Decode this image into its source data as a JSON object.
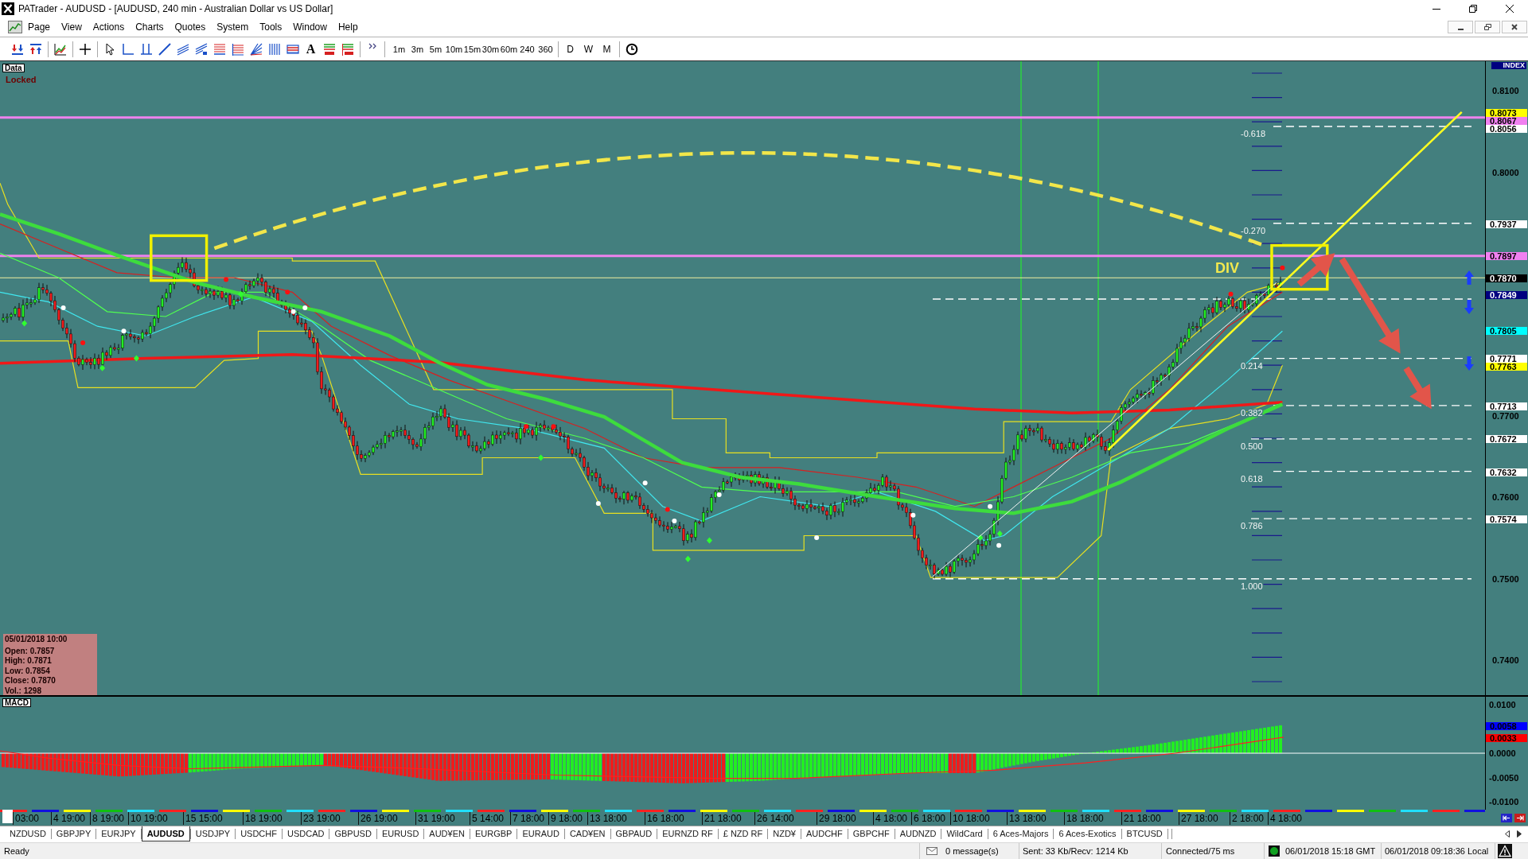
{
  "window": {
    "title": "PATrader - AUDUSD - [AUDUSD, 240 min - Australian Dollar vs US Dollar]"
  },
  "menu": [
    "Page",
    "View",
    "Actions",
    "Charts",
    "Quotes",
    "System",
    "Tools",
    "Window",
    "Help"
  ],
  "toolbar": {
    "text_tool": "A",
    "timeframes": [
      "1m",
      "3m",
      "5m",
      "10m",
      "15m",
      "30m",
      "60m",
      "240",
      "360"
    ],
    "periods": [
      "D",
      "W",
      "M"
    ]
  },
  "chart": {
    "data_tag": "Data",
    "lock_status": "Locked",
    "annotation": "DIV",
    "fib_levels": [
      "-0.618",
      "-0.270",
      "0.214",
      "0.382",
      "0.500",
      "0.618",
      "0.786",
      "1.000"
    ],
    "ohlc": {
      "date": "05/01/2018 10:00",
      "lines": [
        "Open: 0.7857",
        "High: 0.7871",
        "Low: 0.7854",
        "Close: 0.7870",
        "Vol.: 1298"
      ]
    },
    "y_axis": {
      "title": "INDEX",
      "labels": [
        "0.8100",
        "0.8000",
        "0.7700",
        "0.7600",
        "0.7500",
        "0.7400"
      ]
    },
    "price_tags": [
      {
        "text": "0.8073",
        "color": "#ffff00"
      },
      {
        "text": "0.8067",
        "color": "#f080f0"
      },
      {
        "text": "0.8056",
        "color": "#ffffff"
      },
      {
        "text": "0.7937",
        "color": "#ffffff"
      },
      {
        "text": "0.7897",
        "color": "#f080f0"
      },
      {
        "text": "0.7870",
        "color": "#000000"
      },
      {
        "text": "0.7849",
        "color": "#000080"
      },
      {
        "text": "0.7805",
        "color": "#00ffff"
      },
      {
        "text": "0.7771",
        "color": "#ffffff"
      },
      {
        "text": "0.7763",
        "color": "#ffff00"
      },
      {
        "text": "0.7713",
        "color": "#ffffff"
      },
      {
        "text": "0.7672",
        "color": "#ffffff"
      },
      {
        "text": "0.7632",
        "color": "#ffffff"
      },
      {
        "text": "0.7574",
        "color": "#ffffff"
      }
    ]
  },
  "macd": {
    "title": "MACD",
    "y_axis": [
      "0.0100",
      "0.0000",
      "-0.0050",
      "-0.0100"
    ],
    "tags": [
      {
        "text": "0.0058",
        "color": "#0000ff"
      },
      {
        "text": "0.0033",
        "color": "#ff0000"
      }
    ]
  },
  "x_axis": [
    "03:00",
    "4 19:00",
    "8 19:00",
    "10 19:00",
    "15 15:00",
    "18 19:00",
    "23 19:00",
    "26 19:00",
    "31 19:00",
    "5 14:00",
    "7 18:00",
    "9 18:00",
    "13 18:00",
    "16 18:00",
    "21 18:00",
    "26 14:00",
    "29 18:00",
    "4 18:00",
    "6 18:00",
    "10 18:00",
    "13 18:00",
    "18 18:00",
    "21 18:00",
    "27 18:00",
    "2 18:00",
    "4 18:00"
  ],
  "symbol_tabs": [
    {
      "label": "NZDUSD",
      "selected": false
    },
    {
      "label": "GBPJPY",
      "selected": false
    },
    {
      "label": "EURJPY",
      "selected": false
    },
    {
      "label": "AUDUSD",
      "selected": true
    },
    {
      "label": "USDJPY",
      "selected": false
    },
    {
      "label": "USDCHF",
      "selected": false
    },
    {
      "label": "USDCAD",
      "selected": false
    },
    {
      "label": "GBPUSD",
      "selected": false
    },
    {
      "label": "EURUSD",
      "selected": false
    },
    {
      "label": "AUD¥EN",
      "selected": false
    },
    {
      "label": "EURGBP",
      "selected": false
    },
    {
      "label": "EURAUD",
      "selected": false
    },
    {
      "label": "CAD¥EN",
      "selected": false
    },
    {
      "label": "GBPAUD",
      "selected": false
    },
    {
      "label": "EURNZD RF",
      "selected": false
    },
    {
      "label": "£ NZD RF",
      "selected": false
    },
    {
      "label": "NZD¥",
      "selected": false
    },
    {
      "label": "AUDCHF",
      "selected": false
    },
    {
      "label": "GBPCHF",
      "selected": false
    },
    {
      "label": "AUDNZD",
      "selected": false
    },
    {
      "label": "WildCard",
      "selected": false
    },
    {
      "label": "6 Aces-Majors",
      "selected": false
    },
    {
      "label": "6 Aces-Exotics",
      "selected": false
    },
    {
      "label": "BTCUSD",
      "selected": false
    }
  ],
  "status_bar": {
    "status": "Ready",
    "messages": "0 message(s)",
    "traffic": "Sent: 33 Kb/Recv: 1214 Kb",
    "connection": "Connected/75 ms",
    "gmt_time": "06/01/2018 15:18 GMT",
    "local_time": "06/01/2018 09:18:36 Local"
  }
}
